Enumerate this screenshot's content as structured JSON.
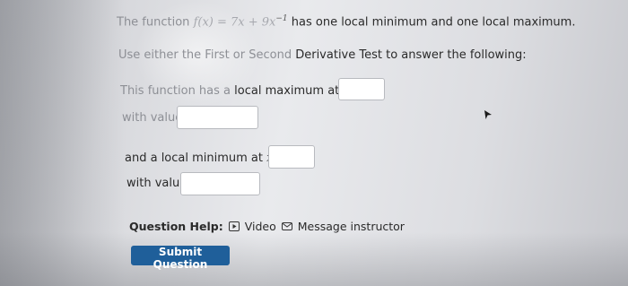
{
  "question": {
    "intro_prefix": "The function",
    "function_expr": "f(x) = 7x + 9x",
    "exponent": "−1",
    "intro_suffix": "has one local minimum and one local maximum.",
    "instruction_prefix": "Use either the First or Second",
    "instruction_suffix": "Derivative Test to answer the following:",
    "max_prefix": "This function has a",
    "max_suffix": "local maximum at",
    "min_label": "and a local minimum at",
    "var_eq": "x =",
    "with_value": "with value",
    "max_x_value": "",
    "max_y_value": "",
    "min_x_value": "",
    "min_y_value": ""
  },
  "help": {
    "label": "Question Help:",
    "video_label": "Video",
    "message_label": "Message instructor",
    "video_icon": "play-icon",
    "message_icon": "envelope-icon"
  },
  "actions": {
    "submit_label": "Submit Question"
  },
  "colors": {
    "submit_bg": "#1f5f9a",
    "text": "#2a2a2a",
    "faded_text": "#8d8f95"
  }
}
